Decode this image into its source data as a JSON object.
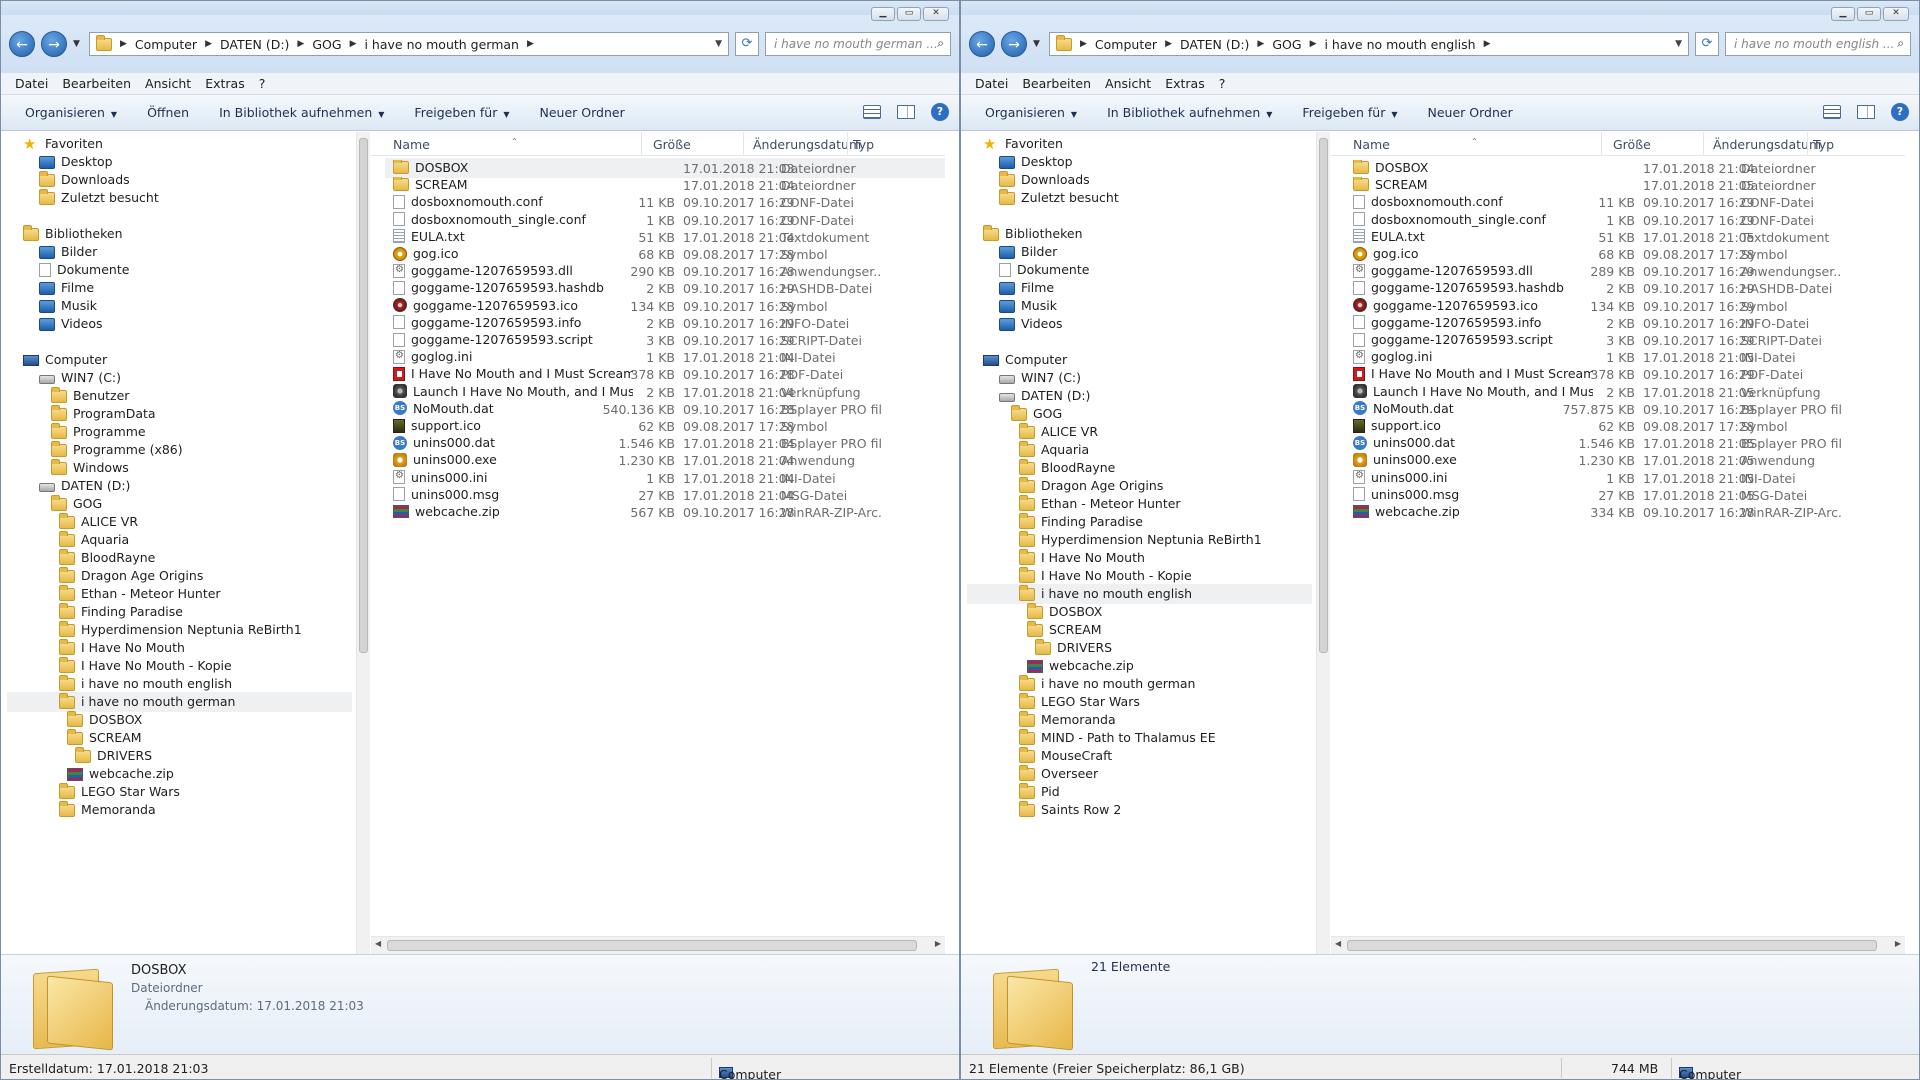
{
  "windows": [
    {
      "caption_buttons": [
        "▁",
        "▭",
        "✕"
      ],
      "breadcrumb": [
        "Computer",
        "DATEN (D:)",
        "GOG",
        "i have no mouth german"
      ],
      "search_placeholder": "i have no mouth german ...",
      "menu": [
        "Datei",
        "Bearbeiten",
        "Ansicht",
        "Extras",
        "?"
      ],
      "commands": [
        {
          "label": "Organisieren",
          "dropdown": true
        },
        {
          "label": "Öffnen",
          "dropdown": false
        },
        {
          "label": "In Bibliothek aufnehmen",
          "dropdown": true
        },
        {
          "label": "Freigeben für",
          "dropdown": true
        },
        {
          "label": "Neuer Ordner",
          "dropdown": false
        }
      ],
      "columns": [
        "Name",
        "Größe",
        "Änderungsdatum",
        "Typ"
      ],
      "nav": [
        {
          "label": "Favoriten",
          "icon": "star",
          "indent": 0
        },
        {
          "label": "Desktop",
          "icon": "blue",
          "indent": 1
        },
        {
          "label": "Downloads",
          "icon": "folder",
          "indent": 1
        },
        {
          "label": "Zuletzt besucht",
          "icon": "folder",
          "indent": 1
        },
        {
          "label": "",
          "icon": "",
          "indent": 0
        },
        {
          "label": "Bibliotheken",
          "icon": "folder",
          "indent": 0
        },
        {
          "label": "Bilder",
          "icon": "blue",
          "indent": 1
        },
        {
          "label": "Dokumente",
          "icon": "file",
          "indent": 1
        },
        {
          "label": "Filme",
          "icon": "blue",
          "indent": 1
        },
        {
          "label": "Musik",
          "icon": "blue",
          "indent": 1
        },
        {
          "label": "Videos",
          "icon": "blue",
          "indent": 1
        },
        {
          "label": "",
          "icon": "",
          "indent": 0
        },
        {
          "label": "Computer",
          "icon": "pc",
          "indent": 0
        },
        {
          "label": "WIN7 (C:)",
          "icon": "drive",
          "indent": 1
        },
        {
          "label": "Benutzer",
          "icon": "folder",
          "indent": 2
        },
        {
          "label": "ProgramData",
          "icon": "folder",
          "indent": 2
        },
        {
          "label": "Programme",
          "icon": "folder",
          "indent": 2
        },
        {
          "label": "Programme (x86)",
          "icon": "folder",
          "indent": 2
        },
        {
          "label": "Windows",
          "icon": "folder",
          "indent": 2
        },
        {
          "label": "DATEN (D:)",
          "icon": "drive",
          "indent": 1
        },
        {
          "label": "GOG",
          "icon": "folder",
          "indent": 2
        },
        {
          "label": "ALICE VR",
          "icon": "folder",
          "indent": 3
        },
        {
          "label": "Aquaria",
          "icon": "folder",
          "indent": 3
        },
        {
          "label": "BloodRayne",
          "icon": "folder",
          "indent": 3
        },
        {
          "label": "Dragon Age Origins",
          "icon": "folder",
          "indent": 3
        },
        {
          "label": "Ethan - Meteor Hunter",
          "icon": "folder",
          "indent": 3
        },
        {
          "label": "Finding Paradise",
          "icon": "folder",
          "indent": 3
        },
        {
          "label": "Hyperdimension Neptunia ReBirth1",
          "icon": "folder",
          "indent": 3
        },
        {
          "label": "I Have No Mouth",
          "icon": "folder",
          "indent": 3
        },
        {
          "label": "I Have No Mouth - Kopie",
          "icon": "folder",
          "indent": 3
        },
        {
          "label": "i have no mouth english",
          "icon": "folder",
          "indent": 3
        },
        {
          "label": "i have no mouth german",
          "icon": "folder",
          "indent": 3,
          "selected": true
        },
        {
          "label": "DOSBOX",
          "icon": "folder",
          "indent": 4
        },
        {
          "label": "SCREAM",
          "icon": "folder",
          "indent": 4
        },
        {
          "label": "DRIVERS",
          "icon": "folder",
          "indent": 5
        },
        {
          "label": "webcache.zip",
          "icon": "zip",
          "indent": 4
        },
        {
          "label": "LEGO Star Wars",
          "icon": "folder",
          "indent": 3
        },
        {
          "label": "Memoranda",
          "icon": "folder",
          "indent": 3
        }
      ],
      "files": [
        {
          "name": "DOSBOX",
          "size": "",
          "date": "17.01.2018 21:03",
          "type": "Dateiordner",
          "icon": "folder",
          "selected": true
        },
        {
          "name": "SCREAM",
          "size": "",
          "date": "17.01.2018 21:04",
          "type": "Dateiordner",
          "icon": "folder"
        },
        {
          "name": "dosboxnomouth.conf",
          "size": "11 KB",
          "date": "09.10.2017 16:29",
          "type": "CONF-Datei",
          "icon": "file"
        },
        {
          "name": "dosboxnomouth_single.conf",
          "size": "1 KB",
          "date": "09.10.2017 16:29",
          "type": "CONF-Datei",
          "icon": "file"
        },
        {
          "name": "EULA.txt",
          "size": "51 KB",
          "date": "17.01.2018 21:04",
          "type": "Textdokument",
          "icon": "txt"
        },
        {
          "name": "gog.ico",
          "size": "68 KB",
          "date": "09.08.2017 17:28",
          "type": "Symbol",
          "icon": "gog"
        },
        {
          "name": "goggame-1207659593.dll",
          "size": "290 KB",
          "date": "09.10.2017 16:28",
          "type": "Anwendungser...",
          "icon": "gear"
        },
        {
          "name": "goggame-1207659593.hashdb",
          "size": "2 KB",
          "date": "09.10.2017 16:29",
          "type": "HASHDB-Datei",
          "icon": "file"
        },
        {
          "name": "goggame-1207659593.ico",
          "size": "134 KB",
          "date": "09.10.2017 16:28",
          "type": "Symbol",
          "icon": "red"
        },
        {
          "name": "goggame-1207659593.info",
          "size": "2 KB",
          "date": "09.10.2017 16:29",
          "type": "INFO-Datei",
          "icon": "file"
        },
        {
          "name": "goggame-1207659593.script",
          "size": "3 KB",
          "date": "09.10.2017 16:29",
          "type": "SCRIPT-Datei",
          "icon": "file"
        },
        {
          "name": "goglog.ini",
          "size": "1 KB",
          "date": "17.01.2018 21:04",
          "type": "INI-Datei",
          "icon": "gear"
        },
        {
          "name": "I Have No Mouth and I Must Scream ...",
          "size": "378 KB",
          "date": "09.10.2017 16:28",
          "type": "PDF-Datei",
          "icon": "pdf"
        },
        {
          "name": "Launch I Have No Mouth, and I Must ...",
          "size": "2 KB",
          "date": "17.01.2018 21:04",
          "type": "Verknüpfung",
          "icon": "lnk"
        },
        {
          "name": "NoMouth.dat",
          "size": "540.136 KB",
          "date": "09.10.2017 16:28",
          "type": "BSplayer PRO file",
          "icon": "bs"
        },
        {
          "name": "support.ico",
          "size": "62 KB",
          "date": "09.08.2017 17:28",
          "type": "Symbol",
          "icon": "sup"
        },
        {
          "name": "unins000.dat",
          "size": "1.546 KB",
          "date": "17.01.2018 21:04",
          "type": "BSplayer PRO file",
          "icon": "bs"
        },
        {
          "name": "unins000.exe",
          "size": "1.230 KB",
          "date": "17.01.2018 21:04",
          "type": "Anwendung",
          "icon": "exe"
        },
        {
          "name": "unins000.ini",
          "size": "1 KB",
          "date": "17.01.2018 21:04",
          "type": "INI-Datei",
          "icon": "gear"
        },
        {
          "name": "unins000.msg",
          "size": "27 KB",
          "date": "17.01.2018 21:04",
          "type": "MSG-Datei",
          "icon": "file"
        },
        {
          "name": "webcache.zip",
          "size": "567 KB",
          "date": "09.10.2017 16:28",
          "type": "WinRAR-ZIP-Arc...",
          "icon": "zip"
        }
      ],
      "details": {
        "name": "DOSBOX",
        "type": "Dateiordner",
        "date_label": "Änderungsdatum:",
        "date": "17.01.2018 21:03",
        "count": ""
      },
      "status": {
        "left": "Erstelldatum: 17.01.2018 21:03",
        "size": "",
        "location": "Computer"
      }
    },
    {
      "caption_buttons": [
        "▁",
        "▭",
        "✕"
      ],
      "breadcrumb": [
        "Computer",
        "DATEN (D:)",
        "GOG",
        "i have no mouth english"
      ],
      "search_placeholder": "i have no mouth english ...",
      "menu": [
        "Datei",
        "Bearbeiten",
        "Ansicht",
        "Extras",
        "?"
      ],
      "commands": [
        {
          "label": "Organisieren",
          "dropdown": true
        },
        {
          "label": "In Bibliothek aufnehmen",
          "dropdown": true
        },
        {
          "label": "Freigeben für",
          "dropdown": true
        },
        {
          "label": "Neuer Ordner",
          "dropdown": false
        }
      ],
      "columns": [
        "Name",
        "Größe",
        "Änderungsdatum",
        "Typ"
      ],
      "nav": [
        {
          "label": "Favoriten",
          "icon": "star",
          "indent": 0
        },
        {
          "label": "Desktop",
          "icon": "blue",
          "indent": 1
        },
        {
          "label": "Downloads",
          "icon": "folder",
          "indent": 1
        },
        {
          "label": "Zuletzt besucht",
          "icon": "folder",
          "indent": 1
        },
        {
          "label": "",
          "icon": "",
          "indent": 0
        },
        {
          "label": "Bibliotheken",
          "icon": "folder",
          "indent": 0
        },
        {
          "label": "Bilder",
          "icon": "blue",
          "indent": 1
        },
        {
          "label": "Dokumente",
          "icon": "file",
          "indent": 1
        },
        {
          "label": "Filme",
          "icon": "blue",
          "indent": 1
        },
        {
          "label": "Musik",
          "icon": "blue",
          "indent": 1
        },
        {
          "label": "Videos",
          "icon": "blue",
          "indent": 1
        },
        {
          "label": "",
          "icon": "",
          "indent": 0
        },
        {
          "label": "Computer",
          "icon": "pc",
          "indent": 0
        },
        {
          "label": "WIN7 (C:)",
          "icon": "drive",
          "indent": 1
        },
        {
          "label": "DATEN (D:)",
          "icon": "drive",
          "indent": 1
        },
        {
          "label": "GOG",
          "icon": "folder",
          "indent": 2
        },
        {
          "label": "ALICE VR",
          "icon": "folder",
          "indent": 3
        },
        {
          "label": "Aquaria",
          "icon": "folder",
          "indent": 3
        },
        {
          "label": "BloodRayne",
          "icon": "folder",
          "indent": 3
        },
        {
          "label": "Dragon Age Origins",
          "icon": "folder",
          "indent": 3
        },
        {
          "label": "Ethan - Meteor Hunter",
          "icon": "folder",
          "indent": 3
        },
        {
          "label": "Finding Paradise",
          "icon": "folder",
          "indent": 3
        },
        {
          "label": "Hyperdimension Neptunia ReBirth1",
          "icon": "folder",
          "indent": 3
        },
        {
          "label": "I Have No Mouth",
          "icon": "folder",
          "indent": 3
        },
        {
          "label": "I Have No Mouth - Kopie",
          "icon": "folder",
          "indent": 3
        },
        {
          "label": "i have no mouth english",
          "icon": "folder",
          "indent": 3,
          "selected": true
        },
        {
          "label": "DOSBOX",
          "icon": "folder",
          "indent": 4
        },
        {
          "label": "SCREAM",
          "icon": "folder",
          "indent": 4
        },
        {
          "label": "DRIVERS",
          "icon": "folder",
          "indent": 5
        },
        {
          "label": "webcache.zip",
          "icon": "zip",
          "indent": 4
        },
        {
          "label": "i have no mouth german",
          "icon": "folder",
          "indent": 3
        },
        {
          "label": "LEGO Star Wars",
          "icon": "folder",
          "indent": 3
        },
        {
          "label": "Memoranda",
          "icon": "folder",
          "indent": 3
        },
        {
          "label": "MIND - Path to Thalamus EE",
          "icon": "folder",
          "indent": 3
        },
        {
          "label": "MouseCraft",
          "icon": "folder",
          "indent": 3
        },
        {
          "label": "Overseer",
          "icon": "folder",
          "indent": 3
        },
        {
          "label": "Pid",
          "icon": "folder",
          "indent": 3
        },
        {
          "label": "Saints Row 2",
          "icon": "folder",
          "indent": 3
        }
      ],
      "files": [
        {
          "name": "DOSBOX",
          "size": "",
          "date": "17.01.2018 21:04",
          "type": "Dateiordner",
          "icon": "folder"
        },
        {
          "name": "SCREAM",
          "size": "",
          "date": "17.01.2018 21:05",
          "type": "Dateiordner",
          "icon": "folder"
        },
        {
          "name": "dosboxnomouth.conf",
          "size": "11 KB",
          "date": "09.10.2017 16:29",
          "type": "CONF-Datei",
          "icon": "file"
        },
        {
          "name": "dosboxnomouth_single.conf",
          "size": "1 KB",
          "date": "09.10.2017 16:29",
          "type": "CONF-Datei",
          "icon": "file"
        },
        {
          "name": "EULA.txt",
          "size": "51 KB",
          "date": "17.01.2018 21:05",
          "type": "Textdokument",
          "icon": "txt"
        },
        {
          "name": "gog.ico",
          "size": "68 KB",
          "date": "09.08.2017 17:28",
          "type": "Symbol",
          "icon": "gog"
        },
        {
          "name": "goggame-1207659593.dll",
          "size": "289 KB",
          "date": "09.10.2017 16:29",
          "type": "Anwendungser...",
          "icon": "gear"
        },
        {
          "name": "goggame-1207659593.hashdb",
          "size": "2 KB",
          "date": "09.10.2017 16:29",
          "type": "HASHDB-Datei",
          "icon": "file"
        },
        {
          "name": "goggame-1207659593.ico",
          "size": "134 KB",
          "date": "09.10.2017 16:29",
          "type": "Symbol",
          "icon": "red"
        },
        {
          "name": "goggame-1207659593.info",
          "size": "2 KB",
          "date": "09.10.2017 16:29",
          "type": "INFO-Datei",
          "icon": "file"
        },
        {
          "name": "goggame-1207659593.script",
          "size": "3 KB",
          "date": "09.10.2017 16:29",
          "type": "SCRIPT-Datei",
          "icon": "file"
        },
        {
          "name": "goglog.ini",
          "size": "1 KB",
          "date": "17.01.2018 21:05",
          "type": "INI-Datei",
          "icon": "gear"
        },
        {
          "name": "I Have No Mouth and I Must Scream ...",
          "size": "378 KB",
          "date": "09.10.2017 16:29",
          "type": "PDF-Datei",
          "icon": "pdf"
        },
        {
          "name": "Launch I Have No Mouth, and I Must ...",
          "size": "2 KB",
          "date": "17.01.2018 21:05",
          "type": "Verknüpfung",
          "icon": "lnk"
        },
        {
          "name": "NoMouth.dat",
          "size": "757.875 KB",
          "date": "09.10.2017 16:29",
          "type": "BSplayer PRO file",
          "icon": "bs"
        },
        {
          "name": "support.ico",
          "size": "62 KB",
          "date": "09.08.2017 17:28",
          "type": "Symbol",
          "icon": "sup"
        },
        {
          "name": "unins000.dat",
          "size": "1.546 KB",
          "date": "17.01.2018 21:05",
          "type": "BSplayer PRO file",
          "icon": "bs"
        },
        {
          "name": "unins000.exe",
          "size": "1.230 KB",
          "date": "17.01.2018 21:05",
          "type": "Anwendung",
          "icon": "exe"
        },
        {
          "name": "unins000.ini",
          "size": "1 KB",
          "date": "17.01.2018 21:05",
          "type": "INI-Datei",
          "icon": "gear"
        },
        {
          "name": "unins000.msg",
          "size": "27 KB",
          "date": "17.01.2018 21:05",
          "type": "MSG-Datei",
          "icon": "file"
        },
        {
          "name": "webcache.zip",
          "size": "334 KB",
          "date": "09.10.2017 16:28",
          "type": "WinRAR-ZIP-Arc...",
          "icon": "zip"
        }
      ],
      "details": {
        "name": "",
        "type": "",
        "date_label": "",
        "date": "",
        "count": "21 Elemente"
      },
      "status": {
        "left": "21 Elemente (Freier Speicherplatz: 86,1 GB)",
        "size": "744 MB",
        "location": "Computer"
      }
    }
  ]
}
